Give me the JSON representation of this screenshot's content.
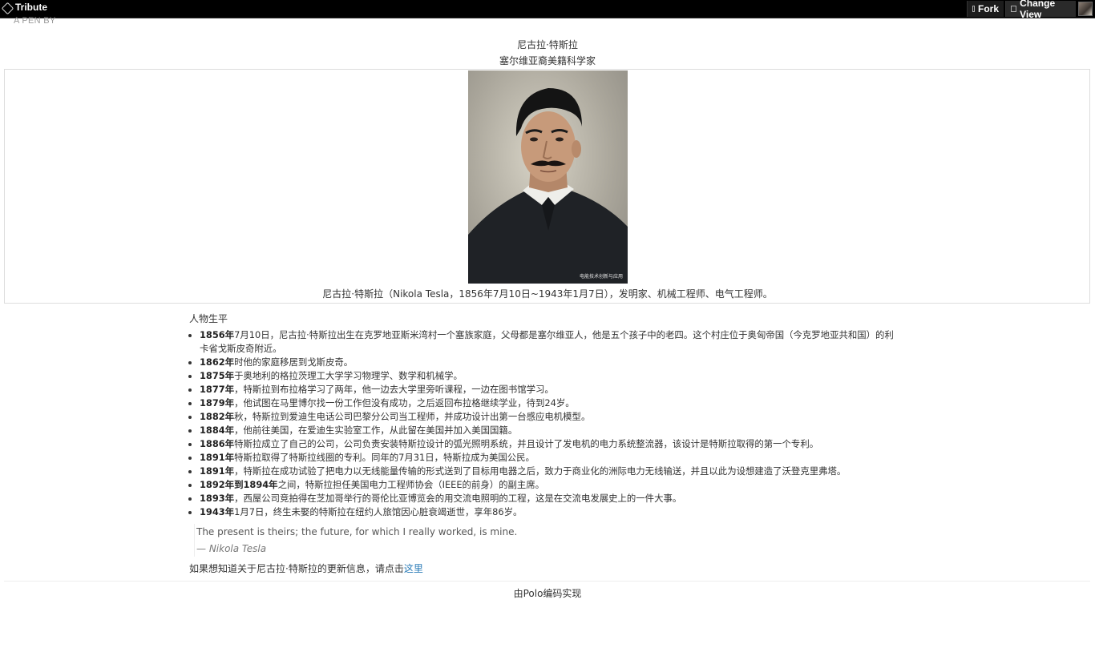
{
  "topbar": {
    "title": "Tribute",
    "fork_label": "Fork",
    "view_label": "Change View"
  },
  "pen_by": "A PEN BY",
  "header": {
    "name": "尼古拉·特斯拉",
    "subtitle": "塞尔维亚裔美籍科学家"
  },
  "image": {
    "watermark": "电能技术创新与应用"
  },
  "caption": "尼古拉·特斯拉（Nikola Tesla，1856年7月10日~1943年1月7日），发明家、机械工程师、电气工程师。",
  "biography": {
    "title": "人物生平",
    "items": [
      {
        "year": "1856年",
        "text": "7月10日，尼古拉·特斯拉出生在克罗地亚斯米湾村一个塞族家庭，父母都是塞尔维亚人，他是五个孩子中的老四。这个村庄位于奥匈帝国（今克罗地亚共和国）的利卡省戈斯皮奇附近。"
      },
      {
        "year": "1862年",
        "text": "时他的家庭移居到戈斯皮奇。"
      },
      {
        "year": "1875年",
        "text": "于奥地利的格拉茨理工大学学习物理学、数学和机械学。"
      },
      {
        "year": "1877年",
        "text": "，特斯拉到布拉格学习了两年，他一边去大学里旁听课程，一边在图书馆学习。"
      },
      {
        "year": "1879年",
        "text": "，他试图在马里博尔找一份工作但没有成功，之后返回布拉格继续学业，待到24岁。"
      },
      {
        "year": "1882年",
        "text": "秋，特斯拉到爱迪生电话公司巴黎分公司当工程师，并成功设计出第一台感应电机模型。"
      },
      {
        "year": "1884年",
        "text": "，他前往美国，在爱迪生实验室工作，从此留在美国并加入美国国籍。"
      },
      {
        "year": "1886年",
        "text": "特斯拉成立了自己的公司，公司负责安装特斯拉设计的弧光照明系统，并且设计了发电机的电力系统整流器，该设计是特斯拉取得的第一个专利。"
      },
      {
        "year": "1891年",
        "text": "特斯拉取得了特斯拉线圈的专利。同年的7月31日，特斯拉成为美国公民。"
      },
      {
        "year": "1891年",
        "text": "，特斯拉在成功试验了把电力以无线能量传输的形式送到了目标用电器之后，致力于商业化的洲际电力无线输送，并且以此为设想建造了沃登克里弗塔。"
      },
      {
        "year": "1892年到1894年",
        "text": "之间，特斯拉担任美国电力工程师协会（IEEE的前身）的副主席。"
      },
      {
        "year": "1893年",
        "text": "，西屋公司竞拍得在芝加哥举行的哥伦比亚博览会的用交流电照明的工程，这是在交流电发展史上的一件大事。"
      },
      {
        "year": "1943年",
        "text": "1月7日，终生未娶的特斯拉在纽约人旅馆因心脏衰竭逝世，享年86岁。"
      }
    ]
  },
  "quote": {
    "text": "The present is theirs; the future, for which I really worked, is mine.",
    "author": "— Nikola Tesla"
  },
  "more_info": {
    "prefix": "如果想知道关于尼古拉·特斯拉的更新信息，请点击",
    "link_text": "这里"
  },
  "footer": "由Polo编码实现"
}
